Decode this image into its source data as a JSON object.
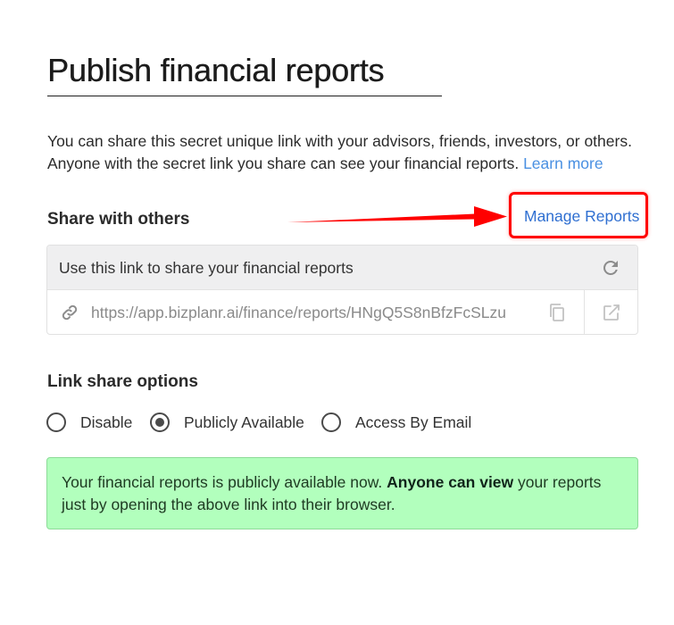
{
  "page": {
    "title": "Publish financial reports",
    "intro_text": "You can share this secret unique link with your advisors, friends, investors, or others. Anyone with the secret link you share can see your financial reports.",
    "learn_more_label": "Learn more"
  },
  "share": {
    "section_title": "Share with others",
    "manage_reports_label": "Manage Reports",
    "highlight_color": "#ff0000",
    "link_card": {
      "header_text": "Use this link to share your financial reports",
      "url": "https://app.bizplanr.ai/finance/reports/HNgQ5S8nBfzFcSLzu",
      "icons": [
        "refresh-icon",
        "link-icon",
        "copy-icon",
        "open-external-icon"
      ]
    }
  },
  "link_share_options": {
    "section_title": "Link share options",
    "options": [
      {
        "label": "Disable",
        "selected": false
      },
      {
        "label": "Publicly Available",
        "selected": true
      },
      {
        "label": "Access By Email",
        "selected": false
      }
    ]
  },
  "status_alert": {
    "text_before": "Your financial reports is publicly available now.",
    "bold_text": "Anyone can view",
    "text_after": "your reports just by opening the above link into their browser.",
    "background_color": "#b2ffbd"
  }
}
